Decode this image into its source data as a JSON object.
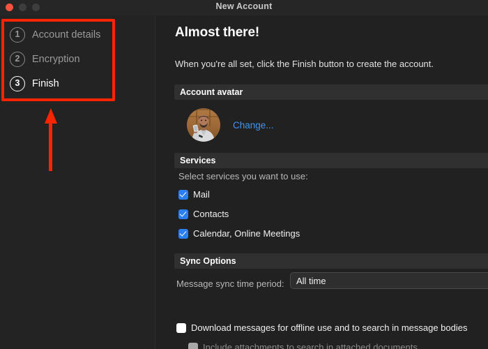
{
  "window": {
    "title": "New Account",
    "traffic_lights": [
      "close",
      "minimize",
      "maximize"
    ]
  },
  "sidebar": {
    "steps": [
      {
        "number": "1",
        "label": "Account details",
        "active": false
      },
      {
        "number": "2",
        "label": "Encryption",
        "active": false
      },
      {
        "number": "3",
        "label": "Finish",
        "active": true
      }
    ]
  },
  "annotation": {
    "color": "#fa2500",
    "shapes": [
      "highlight-box",
      "up-arrow"
    ]
  },
  "content": {
    "heading": "Almost there!",
    "subheading": "When you're all set, click the Finish button to create the account.",
    "sections": {
      "avatar": {
        "header": "Account avatar",
        "change_label": "Change..."
      },
      "services": {
        "header": "Services",
        "intro": "Select services you want to use:",
        "items": [
          {
            "label": "Mail",
            "checked": true,
            "disabled": false
          },
          {
            "label": "Contacts",
            "checked": true,
            "disabled": false
          },
          {
            "label": "Calendar, Online Meetings",
            "checked": true,
            "disabled": false
          }
        ]
      },
      "sync": {
        "header": "Sync Options",
        "period_label": "Message sync time period:",
        "period_value": "All time",
        "options": [
          {
            "label": "Download messages for offline use and to search in message bodies",
            "checked": false,
            "disabled": false
          },
          {
            "label": "Include attachments to search in attached documents",
            "checked": false,
            "disabled": true
          }
        ]
      }
    }
  },
  "colors": {
    "accent_blue": "#2b7ff5",
    "link_blue": "#3f96f0",
    "annotation_red": "#fa2500",
    "window_bg": "#212121",
    "sidebar_bg": "#232323",
    "section_header_bg": "#303030"
  }
}
